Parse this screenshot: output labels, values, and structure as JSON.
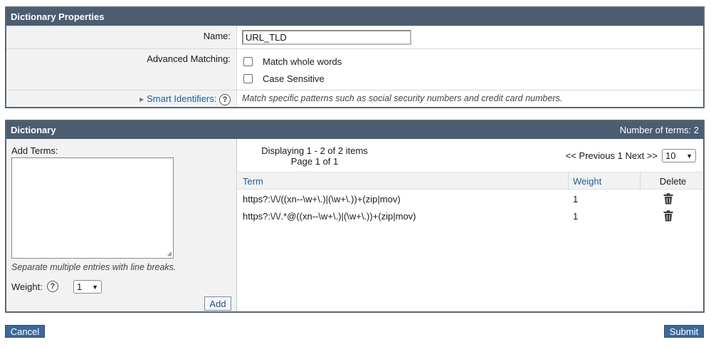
{
  "properties": {
    "header": "Dictionary Properties",
    "name_label": "Name:",
    "name_value": "URL_TLD",
    "advanced_label": "Advanced Matching:",
    "opt_whole_words": "Match whole words",
    "opt_case_sensitive": "Case Sensitive",
    "smart_label": "Smart Identifiers:",
    "smart_note": "Match specific patterns such as social security numbers and credit card numbers.",
    "help_glyph": "?"
  },
  "dictionary": {
    "header": "Dictionary",
    "count_text": "Number of terms: 2",
    "add_terms_label": "Add Terms:",
    "note": "Separate multiple entries with line breaks.",
    "weight_label": "Weight:",
    "weight_value": "1",
    "add_button": "Add",
    "display_line1": "Displaying 1 - 2 of 2 items",
    "display_line2": "Page 1 of 1",
    "pager_text": "<< Previous 1 Next >>",
    "page_size": "10",
    "columns": {
      "term": "Term",
      "weight": "Weight",
      "delete": "Delete"
    },
    "rows": [
      {
        "term": "https?:\\/\\/((xn--\\w+\\.)|(\\w+\\.))+(zip|mov)",
        "weight": "1"
      },
      {
        "term": "https?:\\/\\/.*@((xn--\\w+\\.)|(\\w+\\.))+(zip|mov)",
        "weight": "1"
      }
    ]
  },
  "footer": {
    "cancel": "Cancel",
    "submit": "Submit"
  },
  "colors": {
    "header_bg": "#4c5d72",
    "button_blue": "#3d6896",
    "link": "#1d5e90"
  },
  "icons": [
    "help-icon",
    "triangle-right-icon",
    "trash-icon",
    "chevron-down-icon"
  ]
}
